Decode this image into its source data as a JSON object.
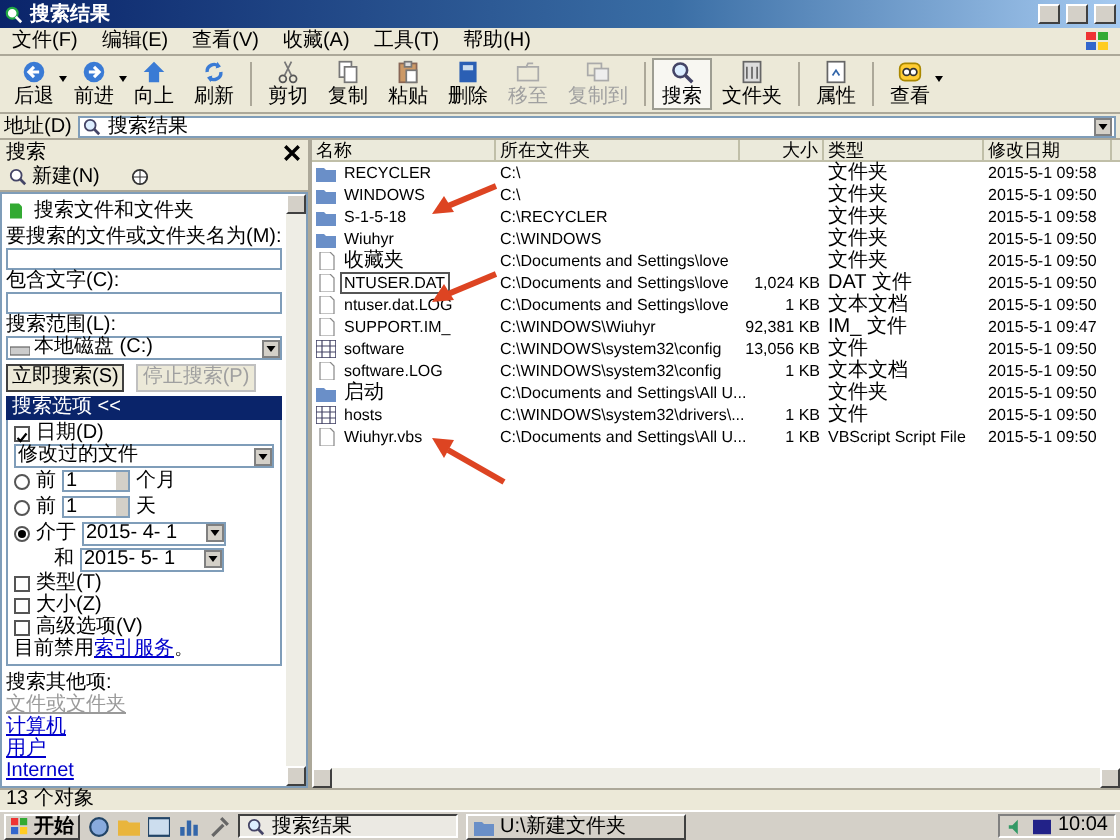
{
  "window": {
    "title": "搜索结果"
  },
  "menu": [
    "文件(F)",
    "编辑(E)",
    "查看(V)",
    "收藏(A)",
    "工具(T)",
    "帮助(H)"
  ],
  "toolbar": [
    {
      "kind": "back",
      "label": "后退",
      "pressed": false,
      "disabled": false,
      "dropdown": true
    },
    {
      "kind": "forward",
      "label": "前进",
      "pressed": false,
      "disabled": false,
      "dropdown": true
    },
    {
      "kind": "up",
      "label": "向上",
      "pressed": false,
      "disabled": false,
      "dropdown": false
    },
    {
      "kind": "refresh",
      "label": "刷新",
      "pressed": false,
      "disabled": false,
      "dropdown": false,
      "group_end": true
    },
    {
      "kind": "cut",
      "label": "剪切",
      "pressed": false,
      "disabled": false,
      "dropdown": false
    },
    {
      "kind": "copy",
      "label": "复制",
      "pressed": false,
      "disabled": false,
      "dropdown": false
    },
    {
      "kind": "paste",
      "label": "粘贴",
      "pressed": false,
      "disabled": false,
      "dropdown": false
    },
    {
      "kind": "delete",
      "label": "删除",
      "pressed": false,
      "disabled": false,
      "dropdown": false
    },
    {
      "kind": "moveto",
      "label": "移至",
      "pressed": false,
      "disabled": true,
      "dropdown": false
    },
    {
      "kind": "copyto",
      "label": "复制到",
      "pressed": false,
      "disabled": true,
      "dropdown": false,
      "group_end": true
    },
    {
      "kind": "search",
      "label": "搜索",
      "pressed": true,
      "disabled": false,
      "dropdown": false
    },
    {
      "kind": "folders",
      "label": "文件夹",
      "pressed": false,
      "disabled": false,
      "dropdown": false,
      "group_end": true
    },
    {
      "kind": "properties",
      "label": "属性",
      "pressed": false,
      "disabled": false,
      "dropdown": false,
      "group_end": true
    },
    {
      "kind": "views",
      "label": "查看",
      "pressed": false,
      "disabled": false,
      "dropdown": true
    }
  ],
  "address": {
    "label": "地址(D)",
    "value": "搜索结果"
  },
  "search_pane": {
    "title": "搜索",
    "new_button": "新建(N)",
    "heading": "搜索文件和文件夹",
    "name_label": "要搜索的文件或文件夹名为(M):",
    "text_label": "包含文字(C):",
    "scope_label": "搜索范围(L):",
    "scope_value": "本地磁盘 (C:)",
    "buttons": [
      {
        "label": "立即搜索(S)",
        "disabled": false
      },
      {
        "label": "停止搜索(P)",
        "disabled": true
      }
    ],
    "options_title": "搜索选项 <<",
    "date": {
      "label": "日期(D)",
      "checked": true
    },
    "date_kind": "修改过的文件",
    "ranges": [
      {
        "kind": "count",
        "label": "前",
        "value": "1",
        "unit": "个月",
        "selected": false
      },
      {
        "kind": "count",
        "label": "前",
        "value": "1",
        "unit": "天",
        "selected": false
      },
      {
        "kind": "between",
        "label": "介于",
        "value": "2015- 4- 1",
        "and_label": "和",
        "and_value": "2015- 5- 1",
        "selected": true
      }
    ],
    "more": [
      {
        "label": "类型(T)",
        "checked": false
      },
      {
        "label": "大小(Z)",
        "checked": false
      },
      {
        "label": "高级选项(V)",
        "checked": false
      }
    ],
    "note": {
      "text": "目前禁用",
      "link": "索引服务",
      "end": "。"
    },
    "other_label": "搜索其他项:",
    "other_links": [
      {
        "label": "文件或文件夹",
        "disabled": true
      },
      {
        "label": "计算机",
        "disabled": false
      },
      {
        "label": "用户",
        "disabled": false
      },
      {
        "label": "Internet",
        "disabled": false
      }
    ]
  },
  "table": {
    "columns": [
      "名称",
      "所在文件夹",
      "大小",
      "类型",
      "修改日期"
    ],
    "rows": [
      {
        "kind": "folder",
        "name": "RECYCLER",
        "folder": "C:\\",
        "size": "",
        "type": "文件夹",
        "modified": "2015-5-1 09:58",
        "focused": false,
        "arrow": false
      },
      {
        "kind": "folder",
        "name": "WINDOWS",
        "folder": "C:\\",
        "size": "",
        "type": "文件夹",
        "modified": "2015-5-1 09:50",
        "focused": false,
        "arrow": false
      },
      {
        "kind": "folder",
        "name": "S-1-5-18",
        "folder": "C:\\RECYCLER",
        "size": "",
        "type": "文件夹",
        "modified": "2015-5-1 09:58",
        "focused": false,
        "arrow": true,
        "arrow_below": false
      },
      {
        "kind": "folder",
        "name": "Wiuhyr",
        "folder": "C:\\WINDOWS",
        "size": "",
        "type": "文件夹",
        "modified": "2015-5-1 09:50",
        "focused": false,
        "arrow": false
      },
      {
        "kind": "file",
        "name": "收藏夹",
        "folder": "C:\\Documents and Settings\\love",
        "size": "",
        "type": "文件夹",
        "modified": "2015-5-1 09:50",
        "focused": false,
        "arrow": false
      },
      {
        "kind": "file",
        "name": "NTUSER.DAT",
        "folder": "C:\\Documents and Settings\\love",
        "size": "1,024 KB",
        "type": "DAT 文件",
        "modified": "2015-5-1 09:50",
        "focused": true,
        "arrow": false
      },
      {
        "kind": "file",
        "name": "ntuser.dat.LOG",
        "folder": "C:\\Documents and Settings\\love",
        "size": "1 KB",
        "type": "文本文档",
        "modified": "2015-5-1 09:50",
        "focused": false,
        "arrow": true,
        "arrow_below": false
      },
      {
        "kind": "file",
        "name": "SUPPORT.IM_",
        "folder": "C:\\WINDOWS\\Wiuhyr",
        "size": "92,381 KB",
        "type": "IM_ 文件",
        "modified": "2015-5-1 09:47",
        "focused": false,
        "arrow": false
      },
      {
        "kind": "system",
        "name": "software",
        "folder": "C:\\WINDOWS\\system32\\config",
        "size": "13,056 KB",
        "type": "文件",
        "modified": "2015-5-1 09:50",
        "focused": false,
        "arrow": false
      },
      {
        "kind": "file",
        "name": "software.LOG",
        "folder": "C:\\WINDOWS\\system32\\config",
        "size": "1 KB",
        "type": "文本文档",
        "modified": "2015-5-1 09:50",
        "focused": false,
        "arrow": false
      },
      {
        "kind": "folder",
        "name": "启动",
        "folder": "C:\\Documents and Settings\\All U...",
        "size": "",
        "type": "文件夹",
        "modified": "2015-5-1 09:50",
        "focused": false,
        "arrow": false
      },
      {
        "kind": "system",
        "name": "hosts",
        "folder": "C:\\WINDOWS\\system32\\drivers\\...",
        "size": "1 KB",
        "type": "文件",
        "modified": "2015-5-1 09:50",
        "focused": false,
        "arrow": false
      },
      {
        "kind": "file",
        "name": "Wiuhyr.vbs",
        "folder": "C:\\Documents and Settings\\All U...",
        "size": "1 KB",
        "type": "VBScript Script File",
        "modified": "2015-5-1 09:50",
        "focused": false,
        "arrow": true,
        "arrow_below": true
      }
    ]
  },
  "status_bar": "13 个对象",
  "taskbar": {
    "start": "开始",
    "tasks": [
      {
        "label": "搜索结果",
        "selected": true
      },
      {
        "label": "U:\\新建文件夹",
        "selected": false
      }
    ],
    "clock": "10:04"
  }
}
